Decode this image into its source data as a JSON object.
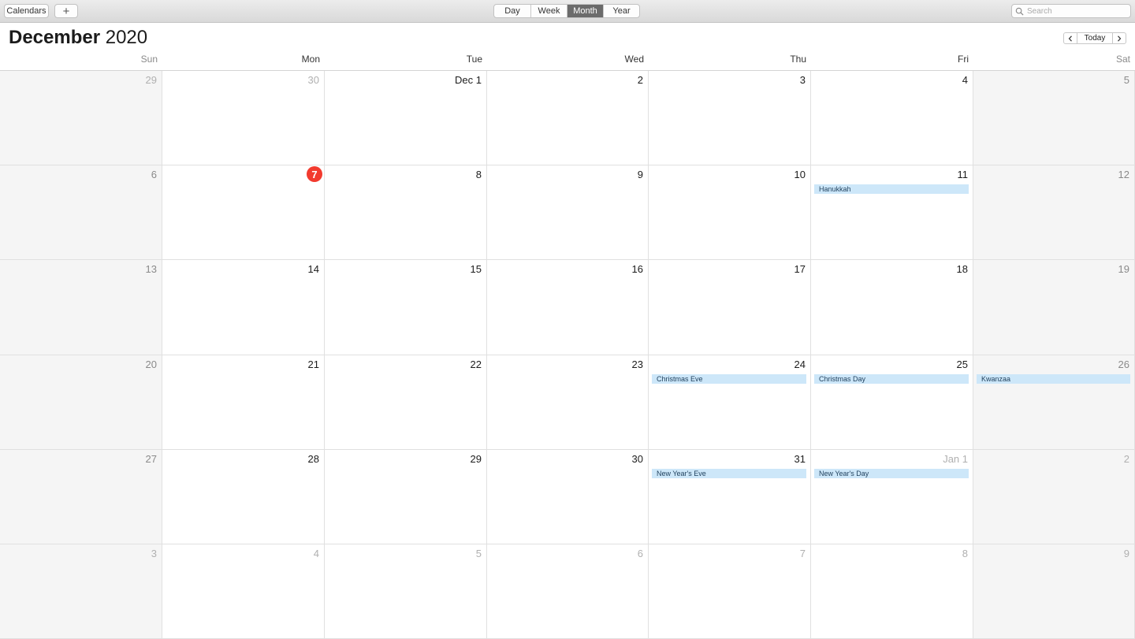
{
  "toolbar": {
    "calendars_label": "Calendars",
    "add_label": "+",
    "views": [
      "Day",
      "Week",
      "Month",
      "Year"
    ],
    "active_view": "Month",
    "search_placeholder": "Search"
  },
  "header": {
    "month": "December",
    "year": "2020",
    "today_label": "Today"
  },
  "weekdays": [
    "Sun",
    "Mon",
    "Tue",
    "Wed",
    "Thu",
    "Fri",
    "Sat"
  ],
  "weeks": [
    [
      {
        "label": "29",
        "muted": true
      },
      {
        "label": "30",
        "muted": true
      },
      {
        "label": "Dec 1"
      },
      {
        "label": "2"
      },
      {
        "label": "3"
      },
      {
        "label": "4"
      },
      {
        "label": "5"
      }
    ],
    [
      {
        "label": "6"
      },
      {
        "label": "7",
        "today": true
      },
      {
        "label": "8"
      },
      {
        "label": "9"
      },
      {
        "label": "10"
      },
      {
        "label": "11",
        "event": "Hanukkah"
      },
      {
        "label": "12"
      }
    ],
    [
      {
        "label": "13"
      },
      {
        "label": "14"
      },
      {
        "label": "15"
      },
      {
        "label": "16"
      },
      {
        "label": "17"
      },
      {
        "label": "18"
      },
      {
        "label": "19"
      }
    ],
    [
      {
        "label": "20"
      },
      {
        "label": "21"
      },
      {
        "label": "22"
      },
      {
        "label": "23"
      },
      {
        "label": "24",
        "event": "Christmas Eve"
      },
      {
        "label": "25",
        "event": "Christmas Day"
      },
      {
        "label": "26",
        "event": "Kwanzaa"
      }
    ],
    [
      {
        "label": "27"
      },
      {
        "label": "28"
      },
      {
        "label": "29"
      },
      {
        "label": "30"
      },
      {
        "label": "31",
        "event": "New Year's Eve"
      },
      {
        "label": "Jan 1",
        "muted": true,
        "event": "New Year's Day"
      },
      {
        "label": "2",
        "muted": true
      }
    ],
    [
      {
        "label": "3",
        "muted": true
      },
      {
        "label": "4",
        "muted": true
      },
      {
        "label": "5",
        "muted": true
      },
      {
        "label": "6",
        "muted": true
      },
      {
        "label": "7",
        "muted": true
      },
      {
        "label": "8",
        "muted": true
      },
      {
        "label": "9",
        "muted": true
      }
    ]
  ],
  "colors": {
    "today_marker": "#f23a2e",
    "event_fill": "#cde7f9",
    "weekend_fill": "#f5f5f5"
  }
}
